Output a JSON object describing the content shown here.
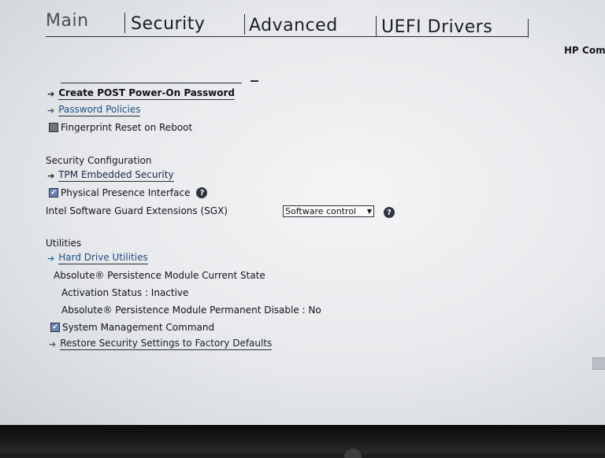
{
  "tabs": [
    {
      "label": "Main"
    },
    {
      "label": "Security"
    },
    {
      "label": "Advanced"
    },
    {
      "label": "UEFI Drivers"
    }
  ],
  "brand": "HP Comp",
  "password": {
    "create_post": "Create POST Power-On Password",
    "policies": "Password Policies",
    "fingerprint_reset": "Fingerprint Reset on Reboot"
  },
  "security_config": {
    "title": "Security Configuration",
    "tpm": "TPM Embedded Security",
    "physical_presence": "Physical Presence Interface",
    "sgx_label": "Intel Software Guard Extensions (SGX)",
    "sgx_value": "Software control"
  },
  "utilities": {
    "title": "Utilities",
    "hard_drive": "Hard Drive Utilities",
    "absolute_state": "Absolute® Persistence Module Current State",
    "activation_status": "Activation Status : Inactive",
    "permanent_disable": "Absolute® Persistence Module Permanent Disable : No",
    "system_mgmt": "System Management Command",
    "restore": "Restore Security Settings to Factory Defaults"
  },
  "checkboxes": {
    "fingerprint_reset": false,
    "physical_presence": true,
    "system_mgmt": true
  },
  "icons": {
    "arrow": "arrow-right-icon",
    "help": "help-icon",
    "dropdown": "chevron-down-icon"
  },
  "colors": {
    "link_blue": "#1e4f86",
    "arrow_blue": "#1e6fa8",
    "background": "#eceef0"
  }
}
